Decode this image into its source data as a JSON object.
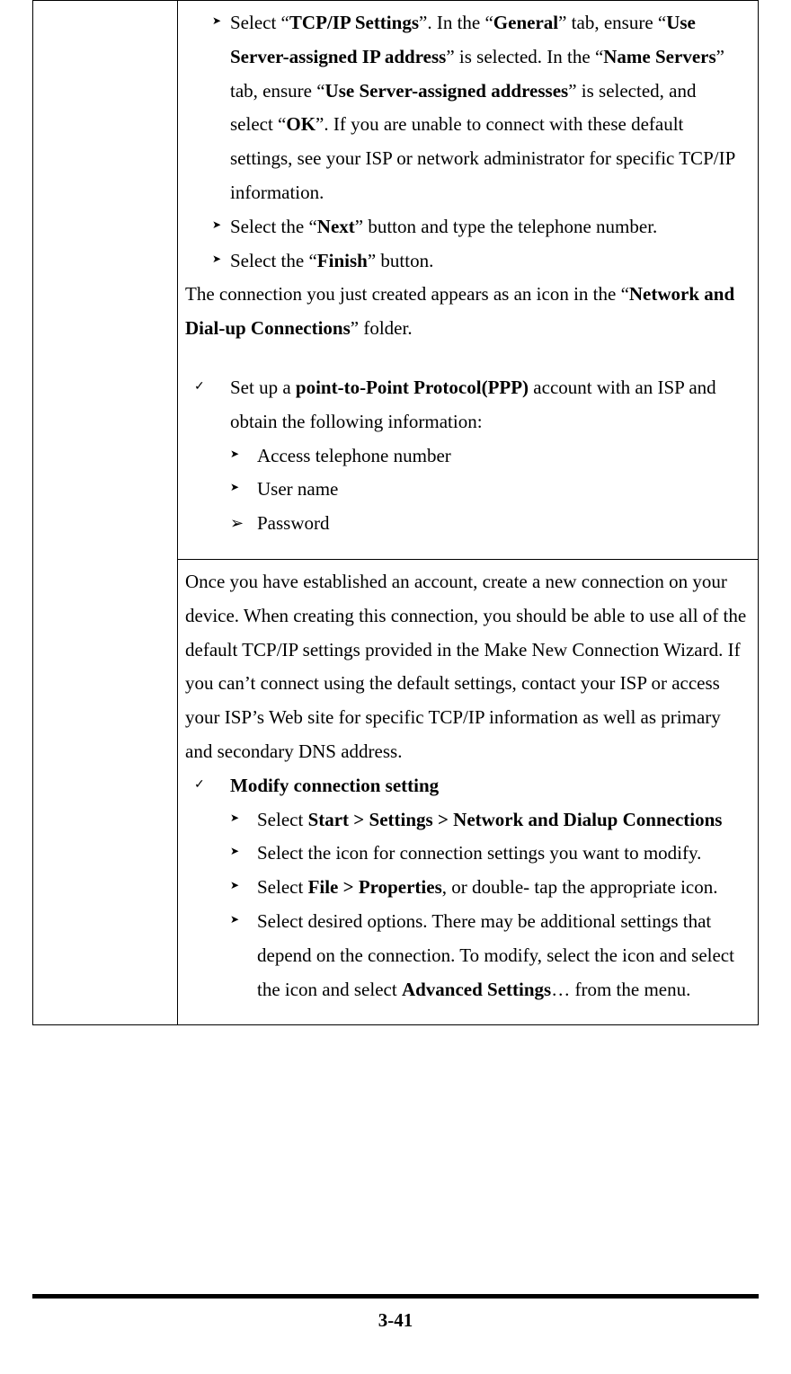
{
  "cell1": {
    "li1": {
      "pre": "Select “",
      "b1": "TCP/IP Settings",
      "mid1": "”. In the “",
      "b2": "General",
      "mid2": "” tab, ensure “",
      "b3": "Use Server-assigned IP address",
      "mid3": "” is selected. In the “",
      "b4": "Name Servers",
      "mid4": "” tab, ensure “",
      "b5": "Use Server-assigned addresses",
      "mid5": "” is selected, and select “",
      "b6": "OK",
      "post": "”. If you are unable to connect with these default settings, see your ISP or network administrator for specific TCP/IP information."
    },
    "li2": {
      "pre": "Select the “",
      "b1": "Next",
      "post": "” button and type the telephone number."
    },
    "li3": {
      "pre": "Select the “",
      "b1": "Finish",
      "post": "” button."
    },
    "para1": {
      "pre": "The connection you just created appears as an icon in the “",
      "b1": "Network and Dial-up Connections",
      "post": "” folder."
    },
    "li4": {
      "pre": "Set up a ",
      "b1": "point-to-Point Protocol(PPP)",
      "post": " account with an ISP and obtain the following information:"
    },
    "li5": "Access telephone number",
    "li6": "User name",
    "li7": "Password"
  },
  "cell2": {
    "para1": "Once you have established an account, create a new connection on your device. When creating this connection, you should be able to use all of the default TCP/IP settings provided in the Make New Connection Wizard. If you can’t connect using the default settings, contact your ISP or access your ISP’s Web site for specific TCP/IP information as well as primary and secondary DNS address.",
    "li1": "Modify connection setting",
    "li2": {
      "pre": "Select ",
      "b1": "Start > Settings > Network and Dialup Connections"
    },
    "li3": "Select the icon for connection settings you want to modify.",
    "li4": {
      "pre": "Select ",
      "b1": "File > Properties",
      "post": ", or double- tap the appropriate icon."
    },
    "li5": {
      "pre": "Select desired options. There may be additional settings that depend on the connection. To modify, select the icon and select the icon and select ",
      "b1": "Advanced Settings",
      "post": "… from the menu."
    }
  },
  "page_number": "3-41"
}
